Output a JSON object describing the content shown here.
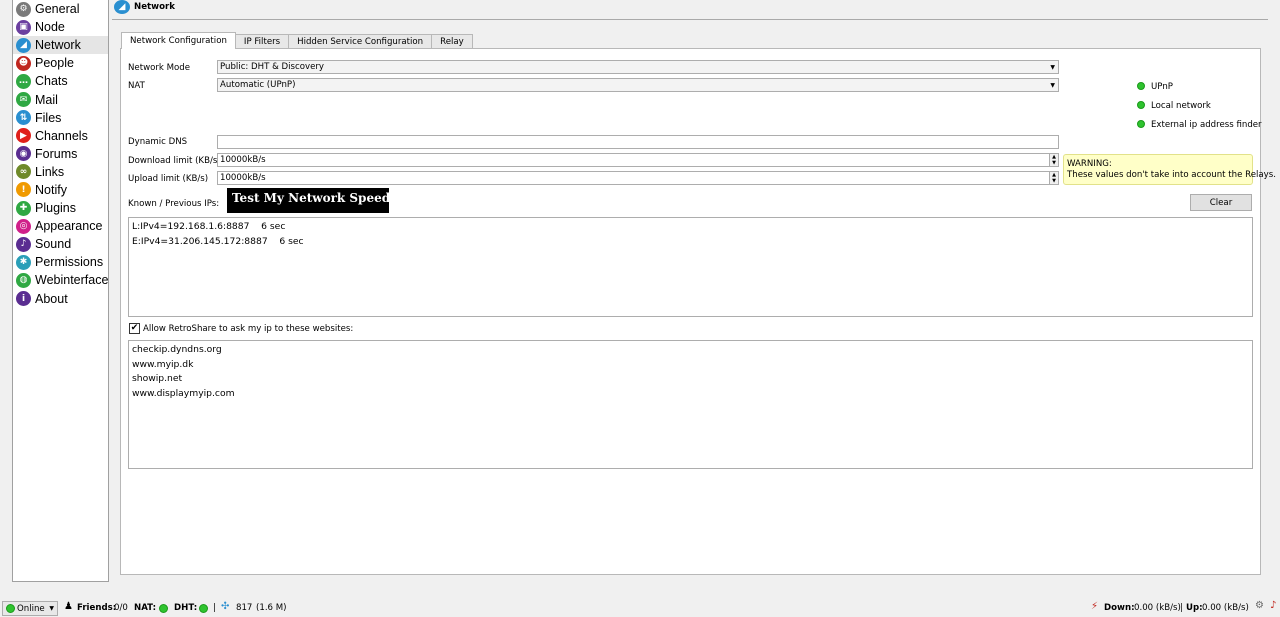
{
  "sidebar": {
    "items": [
      {
        "label": "General",
        "icon": "gear-icon",
        "color": "#7a7a7a",
        "glyph": "⚙"
      },
      {
        "label": "Node",
        "icon": "node-icon",
        "color": "#6b3fa0",
        "glyph": "▣"
      },
      {
        "label": "Network",
        "icon": "network-icon",
        "color": "#2a8fd0",
        "glyph": "◢"
      },
      {
        "label": "People",
        "icon": "people-icon",
        "color": "#c0261f",
        "glyph": "☻"
      },
      {
        "label": "Chats",
        "icon": "chats-icon",
        "color": "#2fa843",
        "glyph": "…"
      },
      {
        "label": "Mail",
        "icon": "mail-icon",
        "color": "#2fa843",
        "glyph": "✉"
      },
      {
        "label": "Files",
        "icon": "files-icon",
        "color": "#2a8fd0",
        "glyph": "⇅"
      },
      {
        "label": "Channels",
        "icon": "channels-icon",
        "color": "#e0201b",
        "glyph": "▶"
      },
      {
        "label": "Forums",
        "icon": "forums-icon",
        "color": "#5a2d91",
        "glyph": "◉"
      },
      {
        "label": "Links",
        "icon": "links-icon",
        "color": "#6f8a2a",
        "glyph": "∞"
      },
      {
        "label": "Notify",
        "icon": "notify-icon",
        "color": "#f09a00",
        "glyph": "!"
      },
      {
        "label": "Plugins",
        "icon": "plugins-icon",
        "color": "#2fa843",
        "glyph": "✚"
      },
      {
        "label": "Appearance",
        "icon": "appearance-icon",
        "color": "#d0208a",
        "glyph": "◎"
      },
      {
        "label": "Sound",
        "icon": "sound-icon",
        "color": "#5a2d91",
        "glyph": "♪"
      },
      {
        "label": "Permissions",
        "icon": "permissions-icon",
        "color": "#2a9fb8",
        "glyph": "✱"
      },
      {
        "label": "Webinterface",
        "icon": "webinterface-icon",
        "color": "#2fa843",
        "glyph": "◍"
      },
      {
        "label": "About",
        "icon": "about-icon",
        "color": "#5a2d91",
        "glyph": "i"
      }
    ],
    "selected": "Network"
  },
  "header": {
    "title": "Network"
  },
  "tabs": [
    "Network Configuration",
    "IP Filters",
    "Hidden Service Configuration",
    "Relay"
  ],
  "form": {
    "network_mode_label": "Network Mode",
    "network_mode_value": "Public: DHT & Discovery",
    "nat_label": "NAT",
    "nat_value": "Automatic (UPnP)",
    "dyndns_label": "Dynamic DNS",
    "dyndns_value": "",
    "download_label": "Download limit (KB/s)",
    "download_value": "10000kB/s",
    "upload_label": "Upload limit (KB/s)",
    "upload_value": "10000kB/s",
    "known_ips_label": "Known / Previous IPs:",
    "test_speed_label": "Test My Network Speed",
    "clear_label": "Clear"
  },
  "status_indicators": [
    "UPnP",
    "Local network",
    "External ip address finder"
  ],
  "warning": {
    "title": "WARNING:",
    "text": "These values don't take into account the Relays."
  },
  "known_ips": [
    "L:IPv4=192.168.1.6:8887    6 sec",
    "E:IPv4=31.206.145.172:8887    6 sec"
  ],
  "allow_checkbox": {
    "label": "Allow RetroShare to ask my ip to these websites:",
    "checked": true
  },
  "websites": [
    "checkip.dyndns.org",
    "www.myip.dk",
    "showip.net",
    "www.displaymyip.com"
  ],
  "statusbar": {
    "online": "Online",
    "friends_label": "Friends:",
    "friends_value": "0/0",
    "nat_label": "NAT:",
    "dht_label": "DHT:",
    "separator": "|",
    "peers_count": "817",
    "peers_size": "(1.6 M)",
    "down_label": "Down:",
    "down_value": "0.00 (kB/s)",
    "up_label": "Up:",
    "up_value": "0.00 (kB/s)"
  }
}
